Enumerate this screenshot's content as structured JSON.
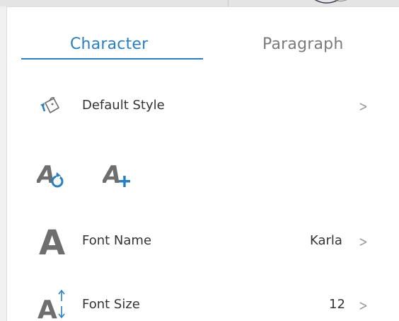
{
  "tabs": {
    "character": "Character",
    "paragraph": "Paragraph"
  },
  "default_style": {
    "label": "Default Style",
    "chevron": ">"
  },
  "style_actions": {
    "update_icon": "update-style-icon",
    "new_icon": "new-style-icon"
  },
  "font_name": {
    "label": "Font Name",
    "value": "Karla",
    "chevron": ">"
  },
  "font_size": {
    "label": "Font Size",
    "value": "12",
    "chevron": ">"
  },
  "colors": {
    "accent": "#2a7fc0",
    "text": "#333333",
    "icon_gray": "#6e6e6e",
    "chevron": "#9a9a9a"
  }
}
